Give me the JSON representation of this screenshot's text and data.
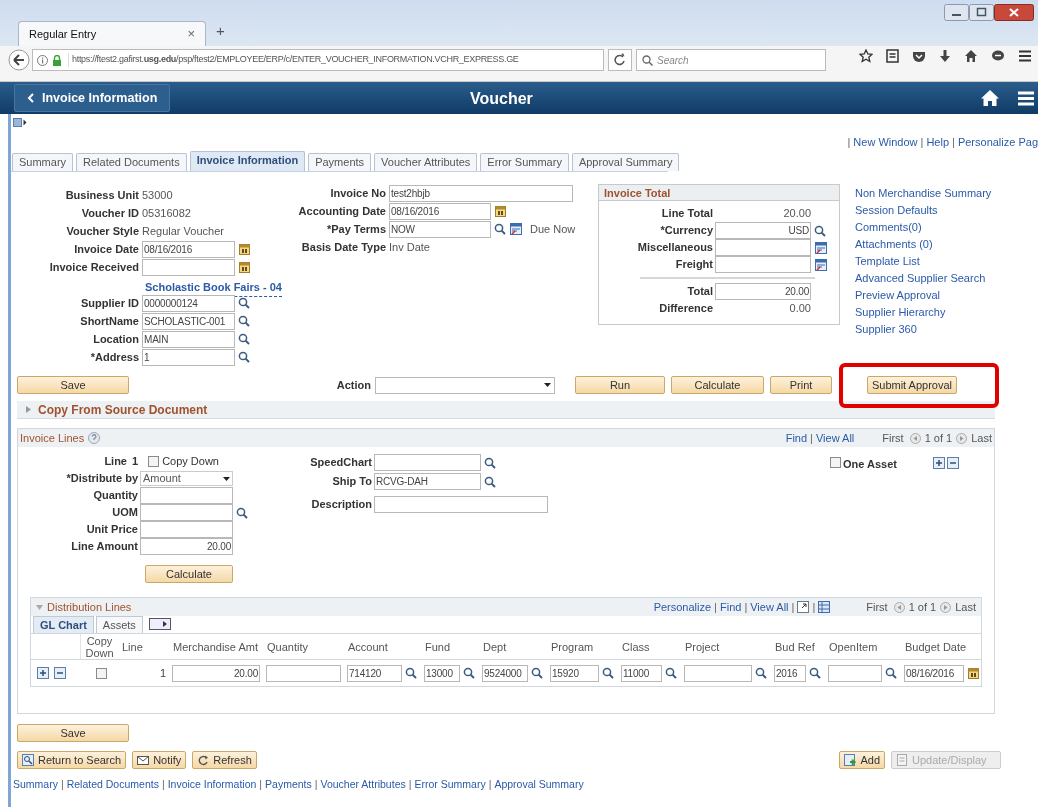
{
  "browser": {
    "tab_title": "Regular Entry",
    "tab_close": "×",
    "new_tab": "+",
    "url": "https://ftest2.gafirst.**usg.edu**/psp/ftest2/EMPLOYEE/ERP/c/ENTER_VOUCHER_INFORMATION.VCHR_EXPRESS.GE",
    "search_placeholder": "Search"
  },
  "header": {
    "back": "Invoice Information",
    "title": "Voucher"
  },
  "page_links": {
    "items": [
      "New Window",
      "Help",
      "Personalize Pag"
    ],
    "separator": "|"
  },
  "tabs": [
    {
      "label": "Summary",
      "selected": false
    },
    {
      "label": "Related Documents",
      "selected": false
    },
    {
      "label": "Invoice Information",
      "selected": true
    },
    {
      "label": "Payments",
      "selected": false
    },
    {
      "label": "Voucher Attributes",
      "selected": false
    },
    {
      "label": "Error Summary",
      "selected": false
    },
    {
      "label": "Approval Summary",
      "selected": false
    }
  ],
  "left_fields": [
    {
      "label": "Business Unit",
      "kind": "static",
      "value": "53000"
    },
    {
      "label": "Voucher ID",
      "kind": "static",
      "value": "05316082"
    },
    {
      "label": "Voucher Style",
      "kind": "static",
      "value": "Regular Voucher"
    },
    {
      "label": "Invoice Date",
      "kind": "date",
      "value": "08/16/2016"
    },
    {
      "label": "Invoice Received",
      "kind": "date"
    },
    {
      "kind": "link",
      "value": "Scholastic Book Fairs - 04"
    },
    {
      "label": "Supplier ID",
      "kind": "lookup",
      "value": "0000000124"
    },
    {
      "label": "ShortName",
      "kind": "lookup",
      "value": "SCHOLASTIC-001"
    },
    {
      "label": "Location",
      "kind": "lookup",
      "value": "MAIN"
    },
    {
      "label": "*Address",
      "kind": "lookup",
      "value": "1"
    }
  ],
  "middle_fields": [
    {
      "label": "Invoice No",
      "kind": "input",
      "value": "test2hbjb"
    },
    {
      "label": "Accounting Date",
      "kind": "date",
      "value": "08/16/2016"
    },
    {
      "label": "*Pay Terms",
      "kind": "lookup",
      "value": "NOW",
      "detail": true,
      "note": "Due Now"
    },
    {
      "label": "Basis Date Type",
      "kind": "static",
      "value": "Inv Date"
    }
  ],
  "invoice_total": {
    "title": "Invoice Total",
    "rows": [
      {
        "label": "Line Total",
        "kind": "static",
        "value": "20.00"
      },
      {
        "label": "*Currency",
        "kind": "lookup",
        "value": "USD"
      },
      {
        "label": "Miscellaneous",
        "kind": "input",
        "detail": true
      },
      {
        "label": "Freight",
        "kind": "input",
        "detail": true
      },
      {
        "kind": "divider"
      },
      {
        "label": "Total",
        "kind": "input",
        "value": "20.00"
      },
      {
        "label": "Difference",
        "kind": "static",
        "value": "0.00"
      }
    ]
  },
  "side_links": [
    "Non Merchandise Summary",
    "Session Defaults",
    "Comments(0)",
    "Attachments (0)",
    "Template List",
    "Advanced Supplier Search",
    "Preview Approval",
    "Supplier Hierarchy",
    "Supplier 360"
  ],
  "action_bar": {
    "save": "Save",
    "action_label": "Action",
    "buttons": [
      {
        "label": "Run",
        "highlighted": false
      },
      {
        "label": "Calculate",
        "highlighted": false
      },
      {
        "label": "Print",
        "highlighted": false
      },
      {
        "label": "Submit Approval",
        "highlighted": true
      }
    ]
  },
  "copy_from": {
    "label": "Copy From Source Document",
    "expanded": false
  },
  "invoice_lines": {
    "title": "Invoice Lines",
    "nav_links": [
      "Find",
      "View All"
    ],
    "separator": "|",
    "nav": {
      "first": "First",
      "count": "1 of 1",
      "last": "Last"
    },
    "line_label": "Line",
    "line_number": "1",
    "copy_down": {
      "label": "Copy Down",
      "checked": false
    },
    "fields": [
      {
        "label": "*Distribute by",
        "kind": "dropdown",
        "value": "Amount"
      },
      {
        "label": "Quantity",
        "kind": "input"
      },
      {
        "label": "UOM",
        "kind": "lookup"
      },
      {
        "label": "Unit Price",
        "kind": "input"
      },
      {
        "label": "Line Amount",
        "kind": "input",
        "value": "20.00"
      }
    ],
    "calculate": "Calculate",
    "middle_fields": [
      {
        "label": "SpeedChart",
        "kind": "lookup"
      },
      {
        "label": "Ship To",
        "kind": "lookup",
        "value": "RCVG-DAH"
      },
      {
        "label": "Description",
        "kind": "input"
      }
    ],
    "one_asset": {
      "label": "One Asset",
      "checked": false
    }
  },
  "distribution_lines": {
    "title": "Distribution Lines",
    "expanded": true,
    "links": [
      "Personalize",
      "Find",
      "View All"
    ],
    "separator": "|",
    "nav": {
      "first": "First",
      "count": "1 of 1",
      "last": "Last"
    },
    "tabs": [
      {
        "label": "GL Chart",
        "selected": true
      },
      {
        "label": "Assets",
        "selected": false
      }
    ],
    "columns": [
      "Copy Down",
      "Line",
      "Merchandise Amt",
      "Quantity",
      "Account",
      "Fund",
      "Dept",
      "Program",
      "Class",
      "Project",
      "Bud Ref",
      "OpenItem",
      "Budget Date"
    ],
    "rows": [
      {
        "cells": [
          {
            "kind": "checkbox",
            "checked": false
          },
          {
            "kind": "text",
            "value": "1"
          },
          {
            "kind": "input",
            "value": "20.00"
          },
          {
            "kind": "input"
          },
          {
            "kind": "lookup",
            "value": "714120"
          },
          {
            "kind": "lookup",
            "value": "13000"
          },
          {
            "kind": "lookup",
            "value": "9524000"
          },
          {
            "kind": "lookup",
            "value": "15920"
          },
          {
            "kind": "lookup",
            "value": "11000"
          },
          {
            "kind": "lookup"
          },
          {
            "kind": "lookup",
            "value": "2016"
          },
          {
            "kind": "lookup"
          },
          {
            "kind": "date",
            "value": "08/16/2016"
          }
        ]
      }
    ]
  },
  "bottom": {
    "save": "Save",
    "left_buttons": [
      {
        "label": "Return to Search",
        "disabled": false
      },
      {
        "label": "Notify",
        "disabled": false
      },
      {
        "label": "Refresh",
        "disabled": false
      }
    ],
    "right_buttons": [
      {
        "label": "Add",
        "disabled": false
      },
      {
        "label": "Update/Display",
        "disabled": true
      }
    ]
  },
  "footer_links": {
    "items": [
      "Summary",
      "Related Documents",
      "Invoice Information",
      "Payments",
      "Voucher Attributes",
      "Error Summary",
      "Approval Summary"
    ],
    "separator": "|"
  }
}
